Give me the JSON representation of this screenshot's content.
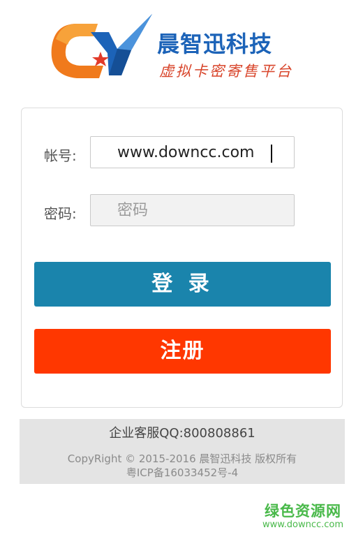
{
  "brand": {
    "name": "晨智迅科技",
    "slogan": "虚拟卡密寄售平台",
    "logo_colors": {
      "orange": "#f07a1c",
      "blue": "#1c63b8",
      "red": "#d8442a"
    }
  },
  "login_form": {
    "account_label": "帐号:",
    "account_value": "www.downcc.com",
    "password_label": "密码:",
    "password_placeholder": "密码",
    "login_button": "登 录",
    "register_button": "注册"
  },
  "footer": {
    "qq": "企业客服QQ:800808861",
    "copyright": "CopyRight © 2015-2016 晨智迅科技 版权所有",
    "icp": "粤ICP备16033452号-4"
  },
  "watermark": {
    "title": "绿色资源网",
    "url": "www.downcc.com"
  },
  "colors": {
    "login_button": "#1a84ac",
    "register_button": "#ff3700",
    "footer_bg": "#e4e4e4",
    "watermark": "#49b94a"
  }
}
